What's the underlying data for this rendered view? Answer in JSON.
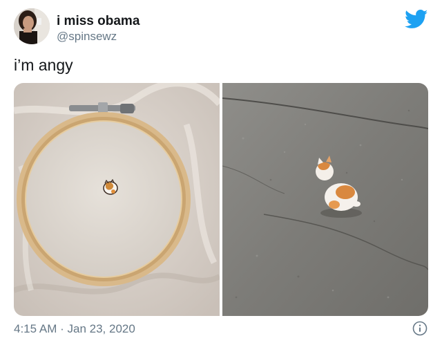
{
  "author": {
    "display_name": "i miss obama",
    "handle": "@spinsewz"
  },
  "tweet": {
    "text": "i’m angy",
    "media_count": 2
  },
  "meta": {
    "time": "4:15 AM",
    "separator": "·",
    "date": "Jan 23, 2020"
  },
  "icons": {
    "brand": "twitter-bird-icon",
    "info": "info-icon"
  },
  "colors": {
    "twitter_blue": "#1da1f2",
    "secondary_text": "#657786",
    "primary_text": "#14171a"
  }
}
